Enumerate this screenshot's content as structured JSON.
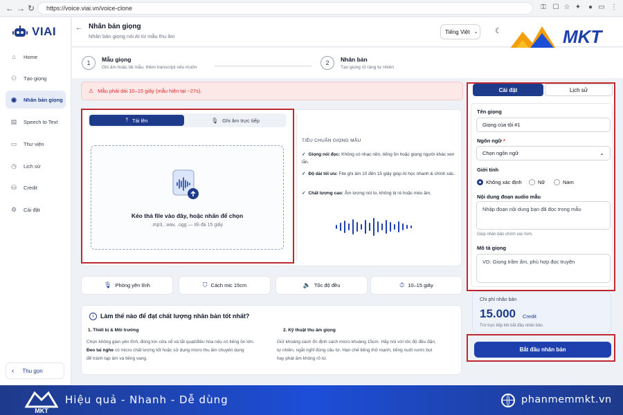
{
  "browser": {
    "url": "https://voice.viai.vn/voice-clone"
  },
  "brand": {
    "name": "VIAI"
  },
  "sidebar": {
    "items": [
      {
        "label": "Home",
        "icon": "home-icon"
      },
      {
        "label": "Tạo giọng",
        "icon": "users-icon"
      },
      {
        "label": "Nhân bản giọng",
        "icon": "clone-voice-icon",
        "active": true
      },
      {
        "label": "Speech to Text",
        "icon": "document-icon"
      },
      {
        "label": "Thư viện",
        "icon": "folder-icon"
      },
      {
        "label": "Lịch sử",
        "icon": "history-icon"
      },
      {
        "label": "Credit",
        "icon": "coins-icon"
      },
      {
        "label": "Cài đặt",
        "icon": "gear-icon"
      }
    ],
    "collapse_label": "Thu gọn"
  },
  "header": {
    "title": "Nhân bản giọng",
    "subtitle": "Nhân bản giọng nói AI từ mẫu thu âm",
    "language": "Tiếng Việt"
  },
  "steps": [
    {
      "num": "1",
      "title": "Mẫu giọng",
      "desc": "Ghi âm hoặc tải mẫu, thêm transcript nếu muốn"
    },
    {
      "num": "2",
      "title": "Nhân bản",
      "desc": "Tạo giọng rõ ràng tự nhiên"
    }
  ],
  "alert": {
    "text": "Mẫu phải dài 10–15 giây (mẫu hiện tại ~27s)."
  },
  "upload": {
    "tab_upload": "Tải lên",
    "tab_record": "Ghi âm trực tiếp",
    "drop_title": "Kéo thả file vào đây, hoặc nhấn để chọn",
    "drop_sub": ".mp3, .wav, .ogg — tối đa 15 giây"
  },
  "standards": {
    "title": "TIÊU CHUẨN GIỌNG MẪU",
    "items": [
      {
        "head": "Giọng nói đọc:",
        "text": "Không có nhạc nền, tiếng ồn hoặc giọng người khác xen lẫn."
      },
      {
        "head": "Độ dài tối ưu:",
        "text": "File ghi âm 10 đến 15 giây giúp AI học nhanh & chính xác."
      },
      {
        "head": "Chất lượng cao:",
        "text": "Âm lượng nói to, không bị rè hoặc méo âm."
      }
    ]
  },
  "pills": [
    {
      "label": "Phòng yên tĩnh",
      "icon": "microphone-icon"
    },
    {
      "label": "Cách mic 15cm",
      "icon": "shield-icon"
    },
    {
      "label": "Tốc độ đều",
      "icon": "speaker-icon"
    },
    {
      "label": "10–15 giây",
      "icon": "stopwatch-icon"
    }
  ],
  "tips": {
    "title": "Làm thế nào để đạt chất lượng nhân bản tốt nhất?",
    "col1_head": "1. Thiết bị & Môi trường",
    "col1_line1": "Chọn không gian yên tĩnh, đóng kín cửa sổ và tắt quạt/điều hòa nếu có tiếng ồn lớn.",
    "col1_bold": "Đeo tai nghe",
    "col1_line2": " có micro chất lượng tốt hoặc sử dụng micro thu âm chuyên dụng",
    "col1_line3": "để tránh tạp âm và tiếng vang.",
    "col2_head": "2. Kỹ thuật thu âm giọng",
    "col2_line1": "Giữ khoảng cách ổn định cách micro khoảng 15cm. Hãy nói với tốc độ đều đặn,",
    "col2_line2": "tự nhiên, ngắt nghỉ đúng câu từ. Hạn chế tiếng thở mạnh, tiếng nuốt nước bọt",
    "col2_line3": "hay phát âm không rõ từ."
  },
  "settings": {
    "tab_settings": "Cài đặt",
    "tab_history": "Lịch sử",
    "name_label": "Tên giọng",
    "name_value": "Giọng của tôi #1",
    "lang_label": "Ngôn ngữ",
    "lang_required": "*",
    "lang_placeholder": "Chọn ngôn ngữ",
    "gender_label": "Giới tính",
    "gender_options": [
      "Không xác định",
      "Nữ",
      "Nam"
    ],
    "gender_selected": "Không xác định",
    "audio_label": "Nội dung đoạn audio mẫu",
    "audio_placeholder": "Nhập đoạn nội dung bạn đã đọc trong mẫu",
    "audio_hint": "Giúp nhân bản chính xác hơn.",
    "desc_label": "Mô tả giọng",
    "desc_placeholder": "VD: Giọng trầm ấm, phù hợp đọc truyện"
  },
  "cost": {
    "label": "Chi phí nhân bản",
    "value": "15.000",
    "unit": "Credit",
    "note": "Trừ trực tiếp khi bắt đầu nhân bản."
  },
  "start_button": "Bắt đầu nhân bản",
  "watermark": {
    "logo_text": "MKT"
  },
  "banner": {
    "slogan": "Hiệu quả - Nhanh - Dễ dùng",
    "website": "phanmemmkt.vn"
  },
  "colors": {
    "primary": "#1e3a8a",
    "alert": "#dc2626",
    "highlight_box": "#c0262d",
    "logo_orange": "#f59e0b"
  }
}
